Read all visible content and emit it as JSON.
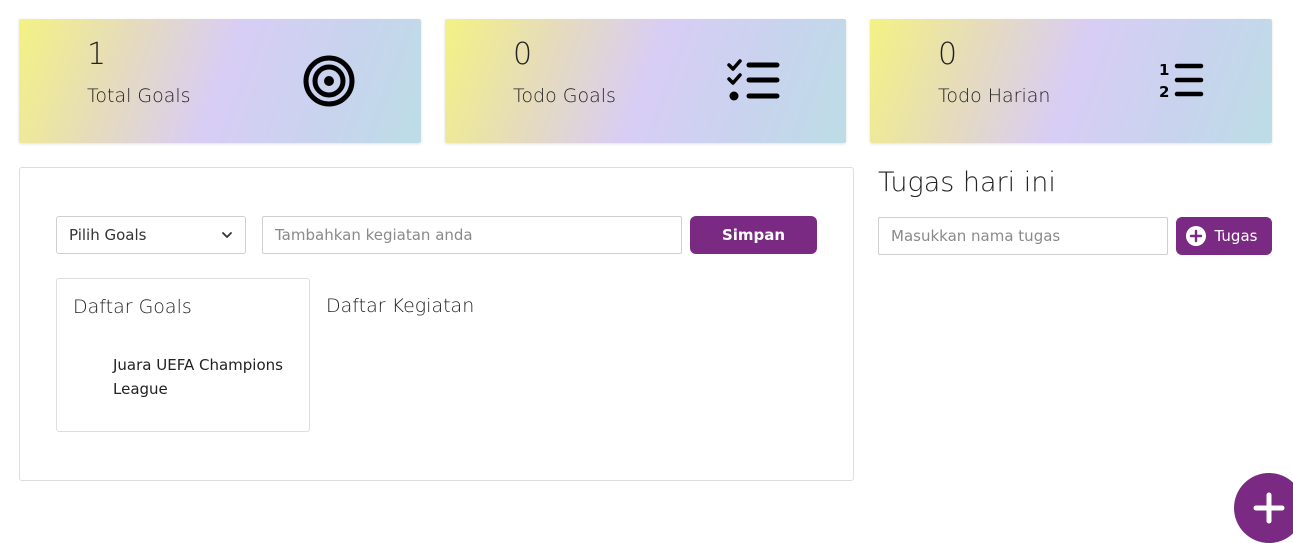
{
  "stats": {
    "total_goals": {
      "value": "1",
      "label": "Total Goals",
      "icon": "target-icon"
    },
    "todo_goals": {
      "value": "0",
      "label": "Todo Goals",
      "icon": "checklist-icon"
    },
    "todo_harian": {
      "value": "0",
      "label": "Todo Harian",
      "icon": "numbered-list-icon"
    }
  },
  "form": {
    "select_label": "Pilih Goals",
    "activity_placeholder": "Tambahkan kegiatan anda",
    "save_label": "Simpan"
  },
  "goals": {
    "title": "Daftar Goals",
    "items": [
      "Juara UEFA Champions League"
    ]
  },
  "activities": {
    "title": "Daftar Kegiatan"
  },
  "tasks": {
    "title": "Tugas hari ini",
    "input_placeholder": "Masukkan nama tugas",
    "add_label": "Tugas"
  },
  "colors": {
    "accent": "#7a2a82",
    "card_gradient": [
      "#f3f283",
      "#d8cdf5",
      "#bcdde6"
    ]
  }
}
